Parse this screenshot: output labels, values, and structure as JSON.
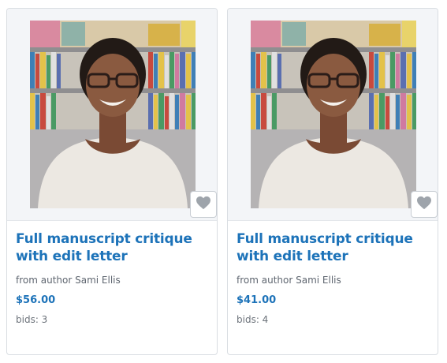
{
  "items": [
    {
      "title": "Full manuscript critique with edit letter",
      "author": "from author Sami Ellis",
      "price": "$56.00",
      "bids": "bids: 3",
      "favorite_icon": "heart-icon",
      "photo_alt": "author photo"
    },
    {
      "title": "Full manuscript critique with edit letter",
      "author": "from author Sami Ellis",
      "price": "$41.00",
      "bids": "bids: 4",
      "favorite_icon": "heart-icon",
      "photo_alt": "author photo"
    }
  ],
  "colors": {
    "title": "#1d73b9",
    "price": "#1d73b9",
    "muted_text": "#5f6670",
    "card_border": "#d9dde2",
    "media_bg": "#f3f5f8",
    "heart": "#9ea4ab"
  }
}
